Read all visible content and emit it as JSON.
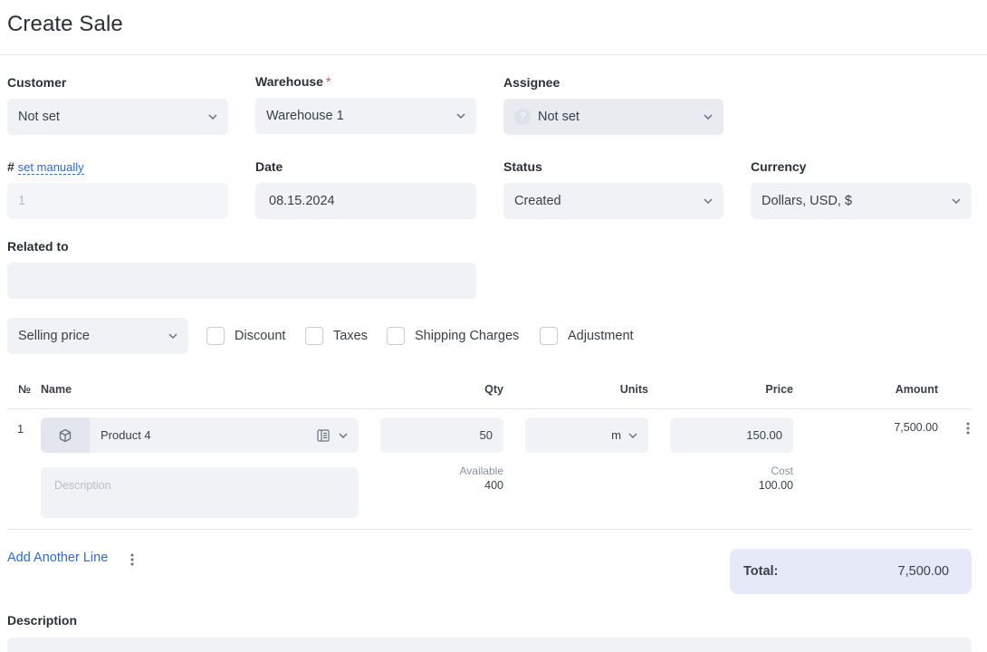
{
  "page": {
    "title": "Create Sale"
  },
  "form": {
    "customer": {
      "label": "Customer",
      "value": "Not set"
    },
    "warehouse": {
      "label": "Warehouse",
      "required_mark": "*",
      "value": "Warehouse 1"
    },
    "assignee": {
      "label": "Assignee",
      "value": "Not set",
      "avatar_glyph": "?"
    },
    "number": {
      "label": "#",
      "link": "set manually",
      "placeholder": "1"
    },
    "date": {
      "label": "Date",
      "value": "08.15.2024"
    },
    "status": {
      "label": "Status",
      "value": "Created"
    },
    "currency": {
      "label": "Currency",
      "value": "Dollars, USD, $"
    },
    "related": {
      "label": "Related to",
      "value": ""
    },
    "price_type": {
      "value": "Selling price"
    },
    "options": [
      {
        "label": "Discount",
        "checked": false
      },
      {
        "label": "Taxes",
        "checked": false
      },
      {
        "label": "Shipping Charges",
        "checked": false
      },
      {
        "label": "Adjustment",
        "checked": false
      }
    ]
  },
  "table": {
    "headers": {
      "no": "№",
      "name": "Name",
      "qty": "Qty",
      "units": "Units",
      "price": "Price",
      "amount": "Amount"
    },
    "rows": [
      {
        "no": "1",
        "product": "Product 4",
        "product_icon": "box-icon",
        "qty": "50",
        "unit": "m",
        "price": "150.00",
        "amount": "7,500.00",
        "description_placeholder": "Description",
        "available_label": "Available",
        "available_value": "400",
        "cost_label": "Cost",
        "cost_value": "100.00"
      }
    ]
  },
  "footer": {
    "add_line": "Add Another Line",
    "total_label": "Total:",
    "total_value": "7,500.00",
    "description_label": "Description"
  },
  "colors": {
    "accent": "#2c6ad6",
    "field_bg": "#f1f2f6",
    "total_bg": "#e6eaf8",
    "required": "#e5484d"
  }
}
